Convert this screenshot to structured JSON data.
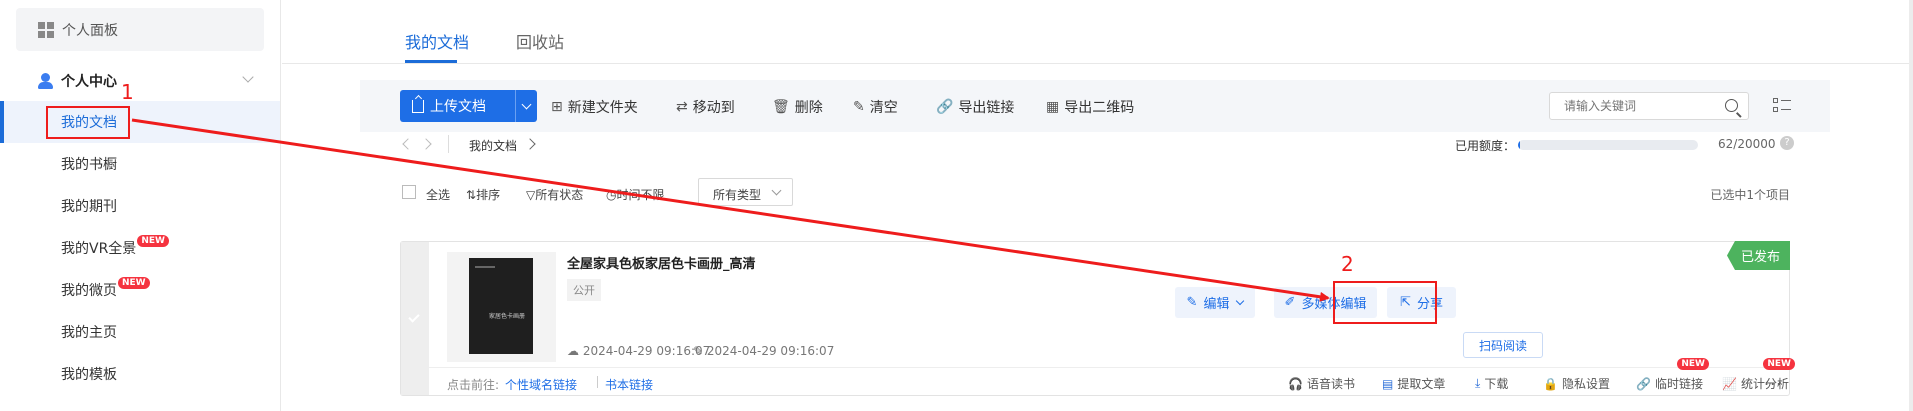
{
  "sidebar": {
    "panel_label": "个人面板",
    "center_label": "个人中心",
    "items": [
      {
        "label": "我的文档"
      },
      {
        "label": "我的书橱"
      },
      {
        "label": "我的期刊"
      },
      {
        "label": "我的VR全景",
        "badge": "NEW"
      },
      {
        "label": "我的微页",
        "badge": "NEW"
      },
      {
        "label": "我的主页"
      },
      {
        "label": "我的模板"
      }
    ]
  },
  "tabs": [
    "我的文档",
    "回收站"
  ],
  "toolbar": {
    "upload_label": "上传文档",
    "new_folder": "新建文件夹",
    "move_to": "移动到",
    "delete": "删除",
    "clear": "清空",
    "export_link": "导出链接",
    "export_qr": "导出二维码",
    "search_placeholder": "请输入关键词"
  },
  "pathbar": {
    "crumb": "我的文档",
    "quota_label": "已用额度：",
    "quota_value": "62/20000",
    "quota_fraction": 0.0031,
    "help": "?"
  },
  "filters": {
    "select_all": "全选",
    "sort": "排序",
    "status": "所有状态",
    "time": "时间不限",
    "type": "所有类型",
    "selected_count": "已选中1个项目"
  },
  "document": {
    "title": "全屋家具色板家居色卡画册_高清",
    "visibility": "公开",
    "created": "2024-04-29 09:16:07",
    "modified": "2024-04-29 09:16:07",
    "status_badge": "已发布",
    "thumb_text": "家居色卡画册",
    "actions": {
      "edit": "编辑",
      "multimedia_edit": "多媒体编辑",
      "share": "分享",
      "scan_read": "扫码阅读"
    },
    "footer": {
      "goto_label": "点击前往:",
      "link_domain": "个性域名链接",
      "link_book": "书本链接",
      "functions": [
        {
          "label": "语音读书"
        },
        {
          "label": "提取文章"
        },
        {
          "label": "下载"
        },
        {
          "label": "隐私设置"
        },
        {
          "label": "临时链接",
          "badge": "NEW"
        },
        {
          "label": "统计分析",
          "badge": "NEW"
        }
      ],
      "more": "..."
    }
  },
  "annotations": {
    "step1": "1",
    "step2": "2",
    "color": "#ee1c1c"
  }
}
